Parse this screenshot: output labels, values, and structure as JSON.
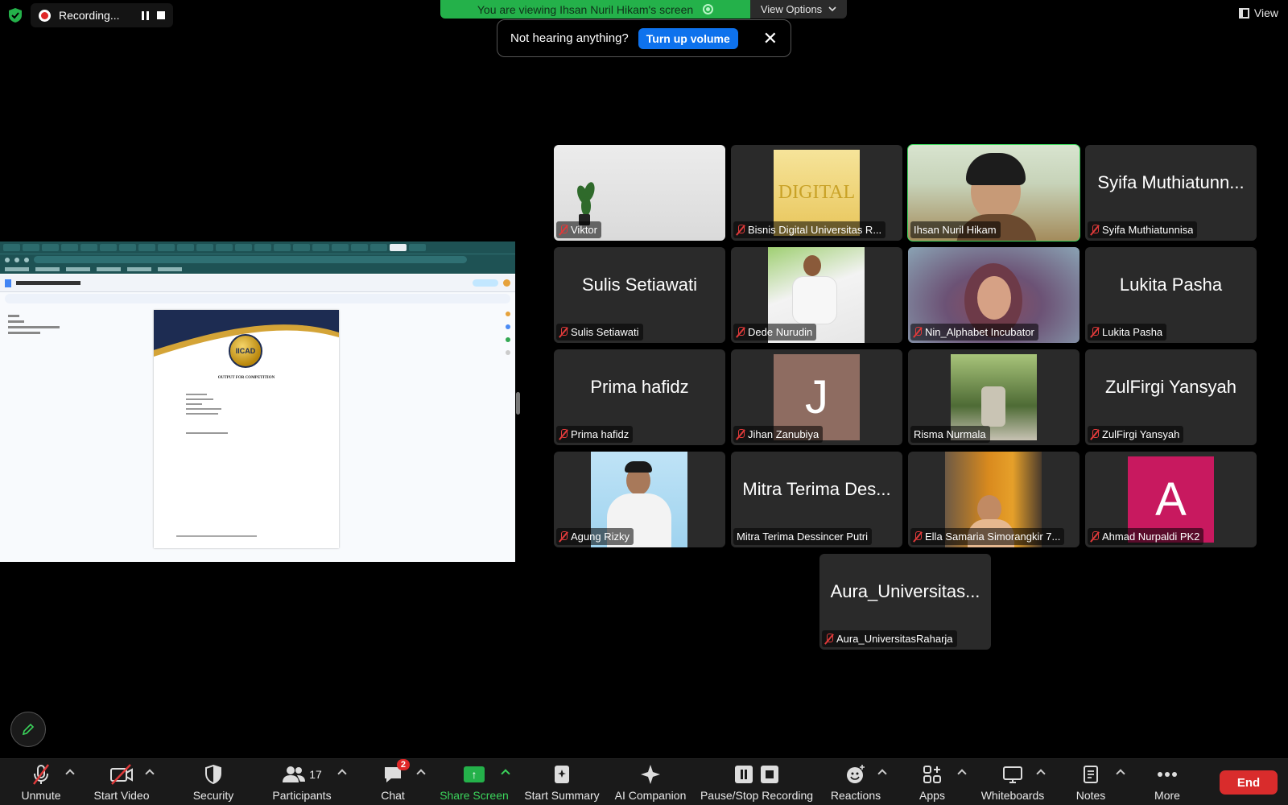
{
  "top": {
    "recording_label": "Recording...",
    "viewing_text": "You are viewing Ihsan Nuril Hikam's screen",
    "view_options_label": "View Options",
    "view_label": "View"
  },
  "popup": {
    "message": "Not hearing anything?",
    "button_label": "Turn up volume"
  },
  "tiles": [
    {
      "display": "",
      "label": "Viktor"
    },
    {
      "display": "",
      "label": "Bisnis Digital Universitas R..."
    },
    {
      "display": "",
      "label": "Ihsan Nuril Hikam"
    },
    {
      "display": "Syifa Muthiatunn...",
      "label": "Syifa Muthiatunnisa"
    },
    {
      "display": "Sulis Setiawati",
      "label": "Sulis Setiawati"
    },
    {
      "display": "",
      "label": "Dede Nurudin"
    },
    {
      "display": "",
      "label": "Nin_Alphabet Incubator"
    },
    {
      "display": "Lukita Pasha",
      "label": "Lukita Pasha"
    },
    {
      "display": "Prima hafidz",
      "label": "Prima hafidz"
    },
    {
      "display": "J",
      "label": "Jihan Zanubiya"
    },
    {
      "display": "",
      "label": "Risma Nurmala"
    },
    {
      "display": "ZulFirgi Yansyah",
      "label": "ZulFirgi Yansyah"
    },
    {
      "display": "",
      "label": "Agung Rizky"
    },
    {
      "display": "Mitra Terima Des...",
      "label": "Mitra Terima Dessincer Putri"
    },
    {
      "display": "",
      "label": "Ella Samaria Simorangkir 7..."
    },
    {
      "display": "A",
      "label": "Ahmad Nurpaldi PK2"
    },
    {
      "display": "Aura_Universitas...",
      "label": "Aura_UniversitasRaharja"
    }
  ],
  "shared_doc": {
    "heading": "OUTPUT FOR COMPETITION",
    "logo_text": "IICAD",
    "bisnis_logo": "DIGITAL"
  },
  "toolbar": {
    "unmute": "Unmute",
    "start_video": "Start Video",
    "security": "Security",
    "participants": "Participants",
    "participants_count": "17",
    "chat": "Chat",
    "chat_badge": "2",
    "share_screen": "Share Screen",
    "start_summary": "Start Summary",
    "ai_companion": "AI Companion",
    "pause_stop": "Pause/Stop Recording",
    "reactions": "Reactions",
    "apps": "Apps",
    "whiteboards": "Whiteboards",
    "notes": "Notes",
    "more": "More",
    "end": "End"
  },
  "colors": {
    "accent_green": "#24b14a",
    "active_speaker_outline": "#3bd35b",
    "end_red": "#d92c2c",
    "turn_up_blue": "#0e72ed"
  }
}
